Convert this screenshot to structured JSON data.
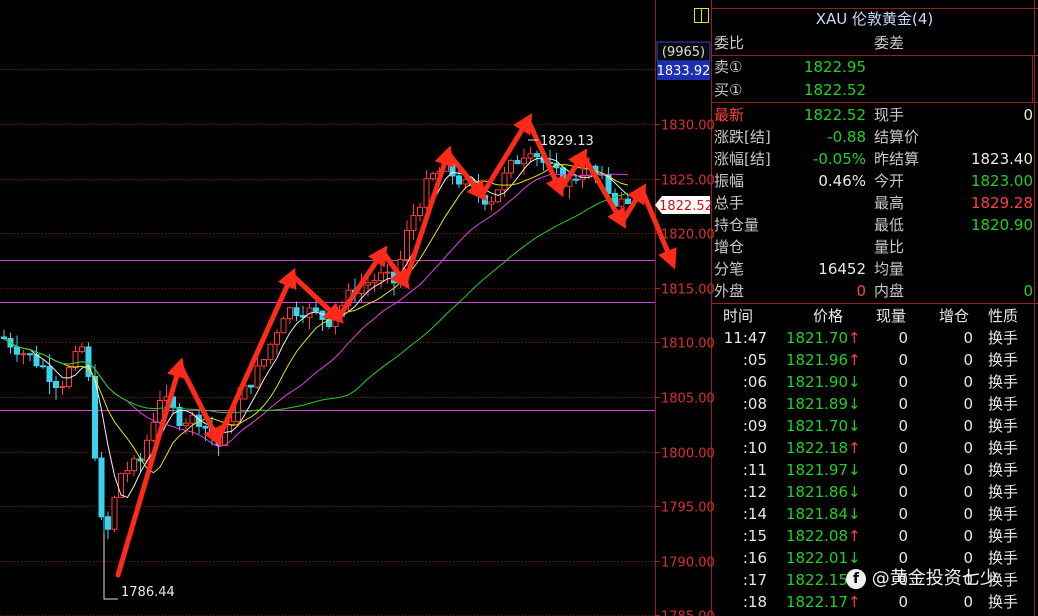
{
  "instrument": {
    "title": "XAU 伦敦黄金(4)",
    "button_label": ""
  },
  "chart_labels": {
    "volume_tag": "(9965)",
    "high_tag": "1833.92",
    "current_price_tag": "1822.52",
    "peak_label": "1829.13",
    "low_label": "1786.44"
  },
  "y_axis_ticks": [
    "1830.00",
    "1825.00",
    "1820.00",
    "1815.00",
    "1810.00",
    "1805.00",
    "1800.00",
    "1795.00",
    "1790.00",
    "1785.00"
  ],
  "quote": {
    "commission_ratio_label": "委比",
    "commission_diff_label": "委差",
    "sell_label": "卖①",
    "sell_value": "1822.95",
    "buy_label": "买①",
    "buy_value": "1822.52",
    "stats": [
      {
        "l1": "最新",
        "v1": "1822.52",
        "c1": "green",
        "l2": "现手",
        "v2": "0",
        "c2": "white",
        "l1c": "red"
      },
      {
        "l1": "涨跌[结]",
        "v1": "-0.88",
        "c1": "green",
        "l2": "结算价",
        "v2": "",
        "c2": "white",
        "l1c": "lbl"
      },
      {
        "l1": "涨幅[结]",
        "v1": "-0.05%",
        "c1": "green",
        "l2": "昨结算",
        "v2": "1823.40",
        "c2": "white",
        "l1c": "lbl"
      },
      {
        "l1": "振幅",
        "v1": "0.46%",
        "c1": "white",
        "l2": "今开",
        "v2": "1823.00",
        "c2": "green",
        "l1c": "lbl"
      },
      {
        "l1": "总手",
        "v1": "",
        "c1": "white",
        "l2": "最高",
        "v2": "1829.28",
        "c2": "red",
        "l1c": "lbl"
      },
      {
        "l1": "持仓量",
        "v1": "",
        "c1": "white",
        "l2": "最低",
        "v2": "1820.90",
        "c2": "green",
        "l1c": "lbl"
      },
      {
        "l1": "增仓",
        "v1": "",
        "c1": "white",
        "l2": "量比",
        "v2": "",
        "c2": "white",
        "l1c": "lbl"
      },
      {
        "l1": "分笔",
        "v1": "16452",
        "c1": "white",
        "l2": "均量",
        "v2": "",
        "c2": "white",
        "l1c": "lbl"
      },
      {
        "l1": "外盘",
        "v1": "0",
        "c1": "red",
        "l2": "内盘",
        "v2": "0",
        "c2": "green",
        "l1c": "lbl"
      }
    ]
  },
  "trades_header": {
    "time": "时间",
    "price": "价格",
    "volume": "现量",
    "oi_change": "增仓",
    "nature": "性质"
  },
  "trades": [
    {
      "time": "11:47",
      "price": "1821.70",
      "dir": "↑",
      "vol": "0",
      "oi": "0",
      "nature": "换手"
    },
    {
      "time": ":05",
      "price": "1821.96",
      "dir": "↑",
      "vol": "0",
      "oi": "0",
      "nature": "换手"
    },
    {
      "time": ":06",
      "price": "1821.90",
      "dir": "↓",
      "vol": "0",
      "oi": "0",
      "nature": "换手"
    },
    {
      "time": ":08",
      "price": "1821.89",
      "dir": "↓",
      "vol": "0",
      "oi": "0",
      "nature": "换手"
    },
    {
      "time": ":09",
      "price": "1821.70",
      "dir": "↓",
      "vol": "0",
      "oi": "0",
      "nature": "换手"
    },
    {
      "time": ":10",
      "price": "1822.18",
      "dir": "↑",
      "vol": "0",
      "oi": "0",
      "nature": "换手"
    },
    {
      "time": ":11",
      "price": "1821.97",
      "dir": "↓",
      "vol": "0",
      "oi": "0",
      "nature": "换手"
    },
    {
      "time": ":12",
      "price": "1821.86",
      "dir": "↓",
      "vol": "0",
      "oi": "0",
      "nature": "换手"
    },
    {
      "time": ":14",
      "price": "1821.84",
      "dir": "↓",
      "vol": "0",
      "oi": "0",
      "nature": "换手"
    },
    {
      "time": ":15",
      "price": "1822.08",
      "dir": "↑",
      "vol": "0",
      "oi": "0",
      "nature": "换手"
    },
    {
      "time": ":16",
      "price": "1822.01",
      "dir": "↓",
      "vol": "0",
      "oi": "0",
      "nature": "换手"
    },
    {
      "time": ":17",
      "price": "1822.15",
      "dir": "↑",
      "vol": "0",
      "oi": "0",
      "nature": "换手"
    },
    {
      "time": ":18",
      "price": "1822.17",
      "dir": "↑",
      "vol": "0",
      "oi": "0",
      "nature": "换手"
    }
  ],
  "watermark": {
    "icon": "f",
    "text": "@黄金投资七少"
  },
  "colors": {
    "up": "#ff3b3b",
    "down": "#38d4ee",
    "ma5": "#f0f0f0",
    "ma10": "#e6e600",
    "ma20": "#e040e0",
    "ma60": "#20d020",
    "grid": "#7a1515",
    "support": "#d040d0",
    "arrow": "#ff2a1a"
  }
}
